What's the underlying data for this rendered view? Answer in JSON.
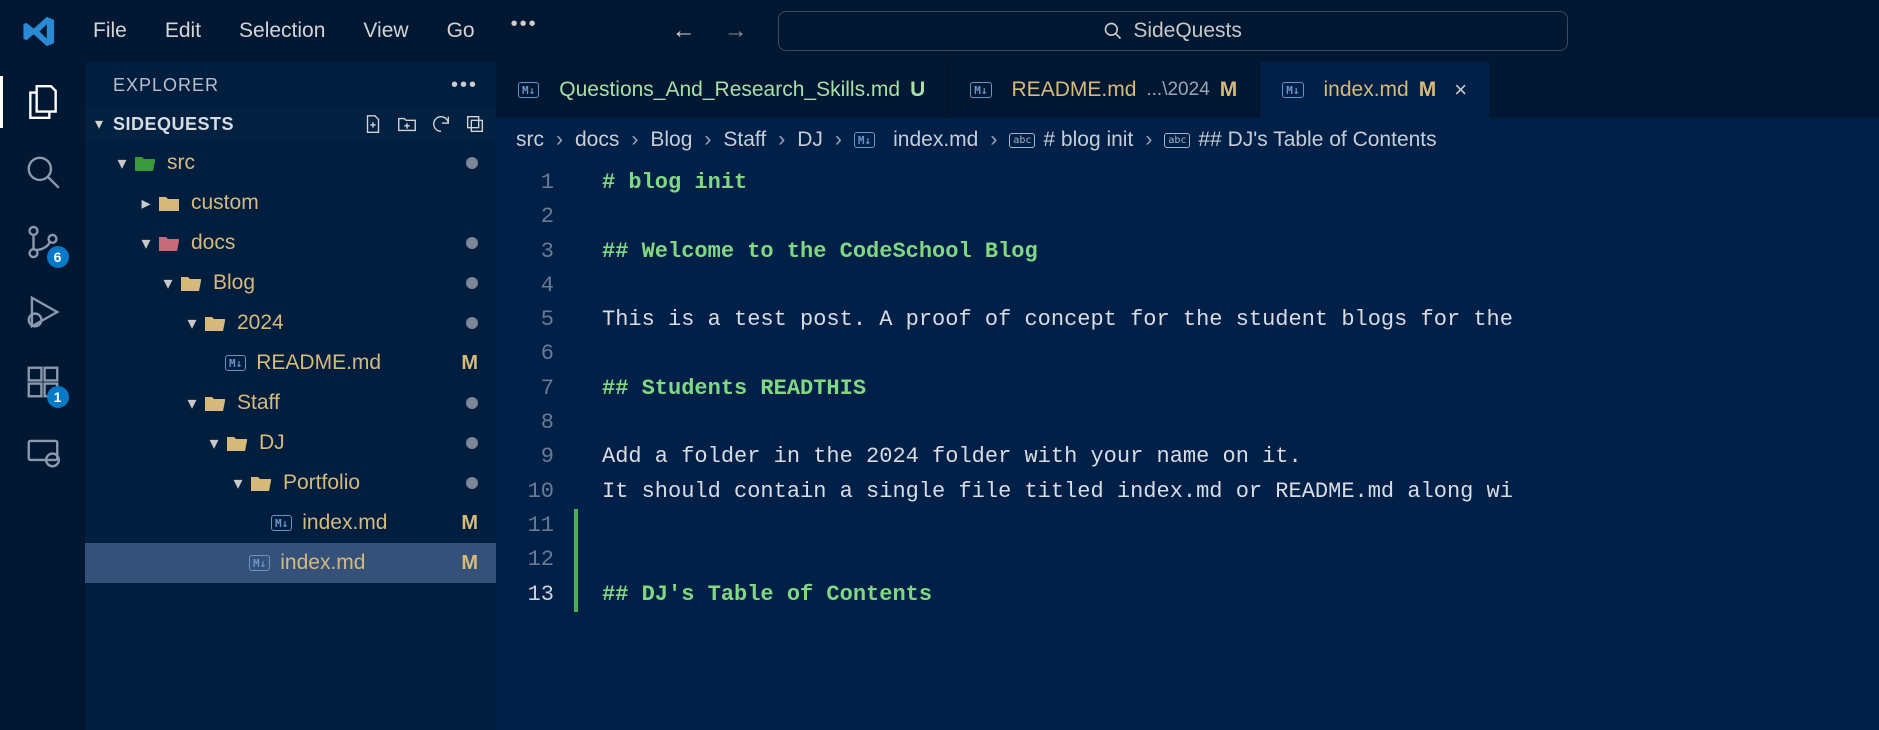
{
  "window": {
    "workspace_name": "SideQuests"
  },
  "menu": {
    "file": "File",
    "edit": "Edit",
    "selection": "Selection",
    "view": "View",
    "go": "Go"
  },
  "activity_bar": {
    "explorer": "explorer",
    "search": "search",
    "scm_badge": "6",
    "extensions_badge": "1"
  },
  "sidebar": {
    "title": "EXPLORER",
    "section_title": "SIDEQUESTS",
    "tree": [
      {
        "label": "src",
        "kind": "folder",
        "indent": 0,
        "expanded": true,
        "icon": "src-folder",
        "status_dot": true
      },
      {
        "label": "custom",
        "kind": "folder",
        "indent": 1,
        "expanded": false,
        "icon": "folder"
      },
      {
        "label": "docs",
        "kind": "folder",
        "indent": 1,
        "expanded": true,
        "icon": "docs-folder",
        "status_dot": true
      },
      {
        "label": "Blog",
        "kind": "folder",
        "indent": 2,
        "expanded": true,
        "icon": "folder-open",
        "status_dot": true
      },
      {
        "label": "2024",
        "kind": "folder",
        "indent": 3,
        "expanded": true,
        "icon": "folder-open",
        "status_dot": true
      },
      {
        "label": "README.md",
        "kind": "file",
        "indent": 4,
        "icon": "md",
        "status": "M"
      },
      {
        "label": "Staff",
        "kind": "folder",
        "indent": 3,
        "expanded": true,
        "icon": "folder-open",
        "status_dot": true
      },
      {
        "label": "DJ",
        "kind": "folder",
        "indent": 4,
        "expanded": true,
        "icon": "folder-open",
        "status_dot": true
      },
      {
        "label": "Portfolio",
        "kind": "folder",
        "indent": 5,
        "expanded": true,
        "icon": "folder-open",
        "status_dot": true
      },
      {
        "label": "index.md",
        "kind": "file",
        "indent": 6,
        "icon": "md",
        "status": "M"
      },
      {
        "label": "index.md",
        "kind": "file",
        "indent": 5,
        "icon": "md",
        "status": "M",
        "selected": true
      }
    ]
  },
  "tabs": [
    {
      "icon": "md",
      "name": "Questions_And_Research_Skills.md",
      "status_letter": "U",
      "modified": false
    },
    {
      "icon": "md",
      "name": "README.md",
      "hint": "...\\2024",
      "status_letter": "M",
      "modified": true
    },
    {
      "icon": "md",
      "name": "index.md",
      "status_letter": "M",
      "modified": true,
      "active": true,
      "closable": true
    }
  ],
  "breadcrumbs": {
    "parts": [
      "src",
      "docs",
      "Blog",
      "Staff",
      "DJ"
    ],
    "file": "index.md",
    "symbol1": "# blog init",
    "symbol2": "## DJ's Table of Contents"
  },
  "editor": {
    "lines": [
      {
        "n": 1,
        "text": "# blog init",
        "heading": true
      },
      {
        "n": 2,
        "text": ""
      },
      {
        "n": 3,
        "text": "## Welcome to the CodeSchool Blog",
        "heading": true
      },
      {
        "n": 4,
        "text": ""
      },
      {
        "n": 5,
        "text": "This is a test post. A proof of concept for the student blogs for the"
      },
      {
        "n": 6,
        "text": ""
      },
      {
        "n": 7,
        "text": "## Students READTHIS",
        "heading": true
      },
      {
        "n": 8,
        "text": ""
      },
      {
        "n": 9,
        "text": "Add a folder in the 2024 folder with your name on it."
      },
      {
        "n": 10,
        "text": "It should contain a single file titled index.md or README.md along wi"
      },
      {
        "n": 11,
        "text": ""
      },
      {
        "n": 12,
        "text": ""
      },
      {
        "n": 13,
        "text": "## DJ's Table of Contents",
        "heading": true
      }
    ]
  }
}
